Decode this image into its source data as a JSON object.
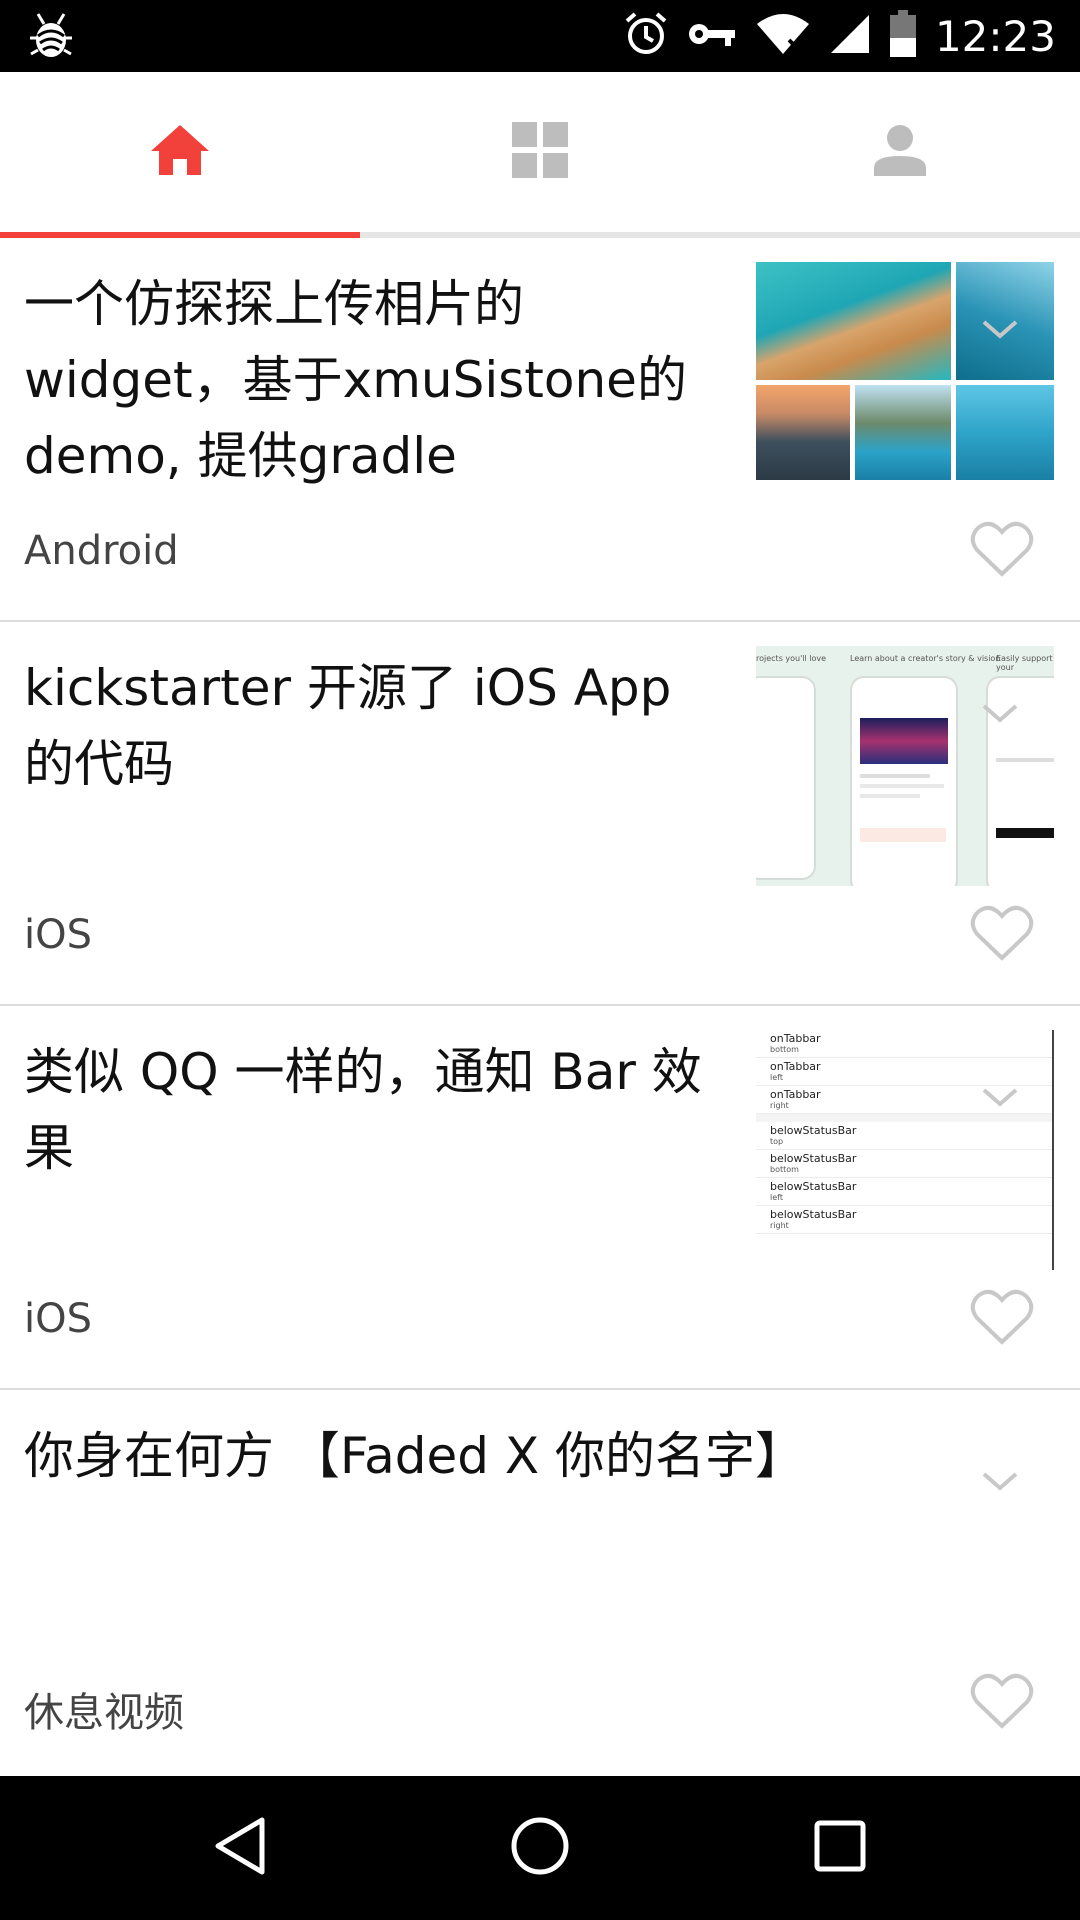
{
  "status_bar": {
    "time": "12:23",
    "icons": [
      "debug-bug-icon",
      "alarm-icon",
      "vpn-key-icon",
      "wifi-icon",
      "signal-icon",
      "battery-icon"
    ]
  },
  "tabs": [
    {
      "name": "home",
      "icon": "home-icon",
      "active": true
    },
    {
      "name": "categories",
      "icon": "grid-icon",
      "active": false
    },
    {
      "name": "profile",
      "icon": "person-icon",
      "active": false
    }
  ],
  "accent_color": "#f2403a",
  "items": [
    {
      "title": "一个仿探探上传相片的widget，基于xmuSistone的demo, 提供gradle import，…",
      "category": "Android",
      "thumb": "gallery"
    },
    {
      "title": "kickstarter 开源了 iOS App 的代码",
      "category": "iOS",
      "thumb": "screens",
      "thumb_captions": [
        "rojects you'll love",
        "Learn about a creator's story & vision",
        "Easily support your"
      ]
    },
    {
      "title": "类似 QQ 一样的，通知 Bar 效果",
      "category": "iOS",
      "thumb": "settings",
      "settings_rows": [
        {
          "a": "onTabbar",
          "b": "bottom"
        },
        {
          "a": "onTabbar",
          "b": "left"
        },
        {
          "a": "onTabbar",
          "b": "right"
        },
        {
          "a": "belowStatusBar",
          "b": "top"
        },
        {
          "a": "belowStatusBar",
          "b": "bottom"
        },
        {
          "a": "belowStatusBar",
          "b": "left"
        },
        {
          "a": "belowStatusBar",
          "b": "right"
        }
      ]
    },
    {
      "title": "你身在何方 【Faded X 你的名字】",
      "category": "休息视频",
      "thumb": "none"
    }
  ],
  "nav_bar": [
    "back-icon",
    "home-circle-icon",
    "recents-icon"
  ]
}
